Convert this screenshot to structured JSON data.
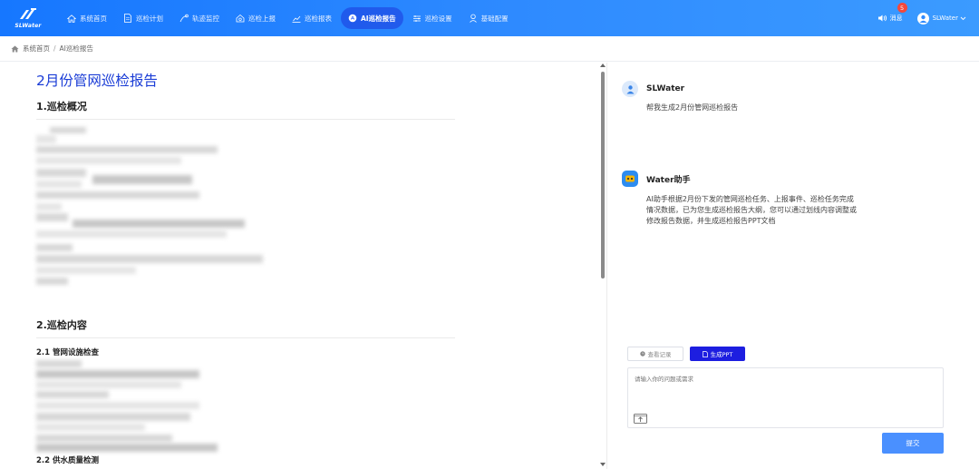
{
  "app": {
    "logo_text": "SLWater"
  },
  "nav": {
    "items": [
      {
        "label": "系统首页",
        "icon": "home-icon"
      },
      {
        "label": "巡检计划",
        "icon": "document-icon"
      },
      {
        "label": "轨迹监控",
        "icon": "track-icon"
      },
      {
        "label": "巡检上报",
        "icon": "report-upload-icon"
      },
      {
        "label": "巡检报表",
        "icon": "chart-icon"
      },
      {
        "label": "AI巡检报告",
        "icon": "ai-icon",
        "active": true
      },
      {
        "label": "巡检设置",
        "icon": "settings-icon"
      },
      {
        "label": "基础配置",
        "icon": "config-icon"
      }
    ]
  },
  "header": {
    "messages_label": "消息",
    "messages_count": "5",
    "username": "SLWater"
  },
  "breadcrumb": {
    "home": "系统首页",
    "separator": "/",
    "current": "AI巡检报告"
  },
  "report": {
    "title": "2月份管网巡检报告",
    "section1": "1.巡检概况",
    "section2": "2.巡检内容",
    "sub21": "2.1 管网设施检查",
    "sub22": "2.2 供水质量检测"
  },
  "chat": {
    "user_name": "SLWater",
    "user_message": "帮我生成2月份管网巡检报告",
    "assistant_name": "Water助手",
    "assistant_lines": [
      "AI助手根据2月份下发的管网巡检任务、上报事件、巡检任务完成",
      "情况数据，已为您生成巡检报告大纲，您可以通过划线内容调整或",
      "修改报告数据，并生成巡检报告PPT文档"
    ],
    "record_button": "查看记录",
    "ppt_button": "生成PPT",
    "input_placeholder": "请输入你的问题或需求",
    "submit_button": "提交"
  },
  "colors": {
    "topbar": "#1677ff",
    "accent": "#1d1ee0",
    "title_blue": "#1a3cd6",
    "submit": "#4a90ff",
    "badge": "#f5483b"
  }
}
